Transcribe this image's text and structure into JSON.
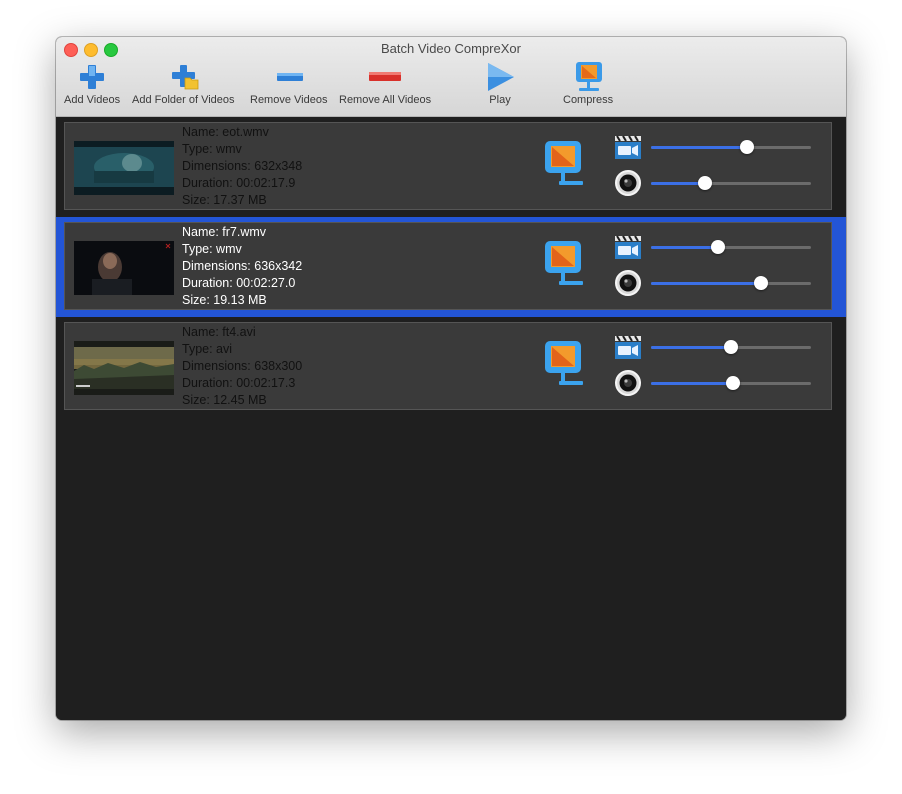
{
  "window": {
    "title": "Batch Video CompreXor"
  },
  "toolbar": {
    "add_videos": "Add Videos",
    "add_folder": "Add Folder of Videos",
    "remove_videos": "Remove Videos",
    "remove_all": "Remove All Videos",
    "play": "Play",
    "compress": "Compress"
  },
  "videos": [
    {
      "name": "Name: eot.wmv",
      "type": "Type: wmv",
      "dimensions": "Dimensions: 632x348",
      "duration": "Duration:  00:02:17.9",
      "size": "Size: 17.37 MB",
      "video_quality": 0.6,
      "audio_quality": 0.34
    },
    {
      "name": "Name: fr7.wmv",
      "type": "Type: wmv",
      "dimensions": "Dimensions: 636x342",
      "duration": "Duration:  00:02:27.0",
      "size": "Size: 19.13 MB",
      "video_quality": 0.42,
      "audio_quality": 0.69
    },
    {
      "name": "Name: ft4.avi",
      "type": "Type: avi",
      "dimensions": "Dimensions: 638x300",
      "duration": "Duration:  00:02:17.3",
      "size": "Size: 12.45 MB",
      "video_quality": 0.5,
      "audio_quality": 0.51
    }
  ],
  "selected_index": 1,
  "colors": {
    "selection": "#2355d6",
    "slider_fill": "#3b6fe6"
  }
}
